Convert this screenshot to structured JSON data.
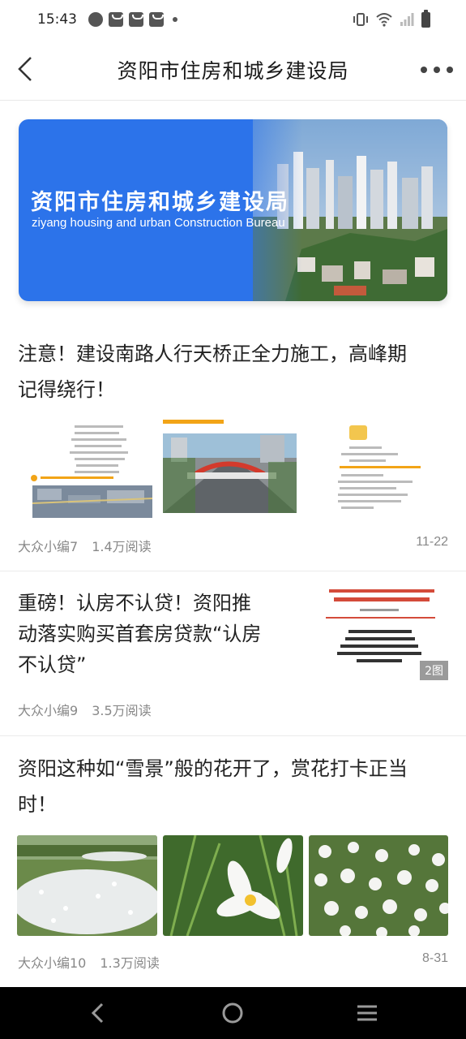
{
  "status_bar": {
    "time": "15:43"
  },
  "header": {
    "title": "资阳市住房和城乡建设局"
  },
  "banner": {
    "title": "资阳市住房和城乡建设局",
    "subtitle": "ziyang housing and urban Construction Bureau",
    "accent_color": "#2c73ea"
  },
  "articles": [
    {
      "title_line1": "注意！建设南路人行天桥正全力施工，高峰期",
      "title_line2": "记得绕行！",
      "author": "大众小编7",
      "reads": "1.4万阅读",
      "date": "11-22"
    },
    {
      "title_line1": "重磅！认房不认贷！资阳推",
      "title_line2": "动落实购买首套房贷款“认房",
      "title_line3": "不认贷”",
      "image_count": "2图",
      "author": "大众小编9",
      "reads": "3.5万阅读",
      "date": ""
    },
    {
      "title_line1": "资阳这种如“雪景”般的花开了，赏花打卡正当",
      "title_line2": "时！",
      "author": "大众小编10",
      "reads": "1.3万阅读",
      "date": "8-31"
    }
  ]
}
